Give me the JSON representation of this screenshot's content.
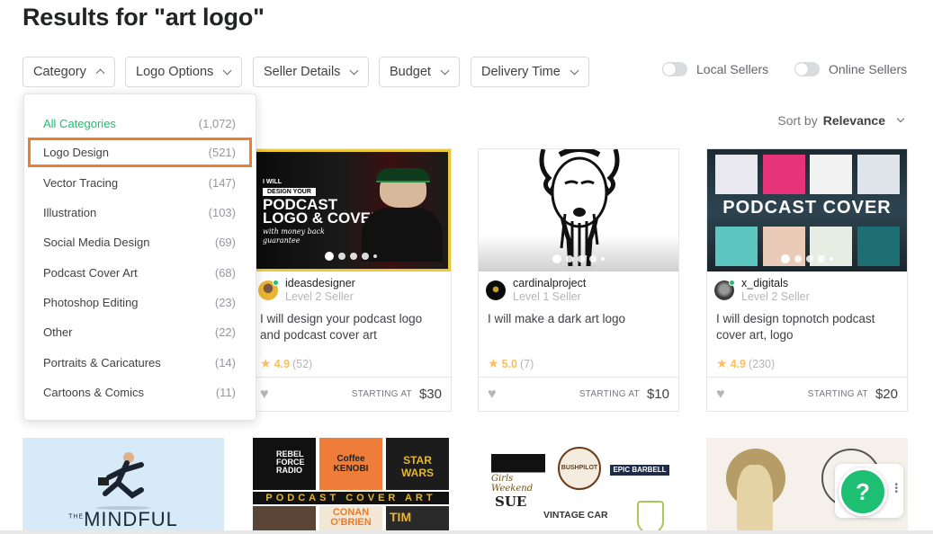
{
  "page": {
    "title": "Results for \"art logo\""
  },
  "filters": [
    {
      "label": "Category",
      "expanded": true
    },
    {
      "label": "Logo Options",
      "expanded": false
    },
    {
      "label": "Seller Details",
      "expanded": false
    },
    {
      "label": "Budget",
      "expanded": false
    },
    {
      "label": "Delivery Time",
      "expanded": false
    }
  ],
  "toggles": [
    {
      "label": "Local Sellers",
      "on": false
    },
    {
      "label": "Online Sellers",
      "on": false
    }
  ],
  "sort": {
    "prefix": "Sort by",
    "value": "Relevance"
  },
  "category_dropdown": {
    "items": [
      {
        "name": "All Categories",
        "count": "(1,072)",
        "active": true
      },
      {
        "name": "Logo Design",
        "count": "(521)",
        "highlighted": true
      },
      {
        "name": "Vector Tracing",
        "count": "(147)"
      },
      {
        "name": "Illustration",
        "count": "(103)"
      },
      {
        "name": "Social Media Design",
        "count": "(69)"
      },
      {
        "name": "Podcast Cover Art",
        "count": "(68)"
      },
      {
        "name": "Photoshop Editing",
        "count": "(23)"
      },
      {
        "name": "Other",
        "count": "(22)"
      },
      {
        "name": "Portraits & Caricatures",
        "count": "(14)"
      },
      {
        "name": "Cartoons & Comics",
        "count": "(11)"
      }
    ]
  },
  "gigs": [
    {
      "thumb": {
        "line1": "I WILL",
        "line2": "DESIGN YOUR",
        "line3": "PODCAST",
        "line4": "LOGO & COVER",
        "line5": "with money back guarantee"
      },
      "seller": "ideasdesigner",
      "level": "Level 2 Seller",
      "online": true,
      "title": "I will design your podcast logo and podcast cover art",
      "rating": "4.9",
      "reviews": "(52)",
      "starting_label": "STARTING AT",
      "price": "$30"
    },
    {
      "thumb": {},
      "seller": "cardinalproject",
      "level": "Level 1 Seller",
      "online": false,
      "title": "I will make a dark art logo",
      "rating": "5.0",
      "reviews": "(7)",
      "starting_label": "STARTING AT",
      "price": "$10"
    },
    {
      "thumb": {
        "banner": "PODCAST COVER"
      },
      "seller": "x_digitals",
      "level": "Level 2 Seller",
      "online": true,
      "title": "I will design topnotch podcast cover art, logo",
      "rating": "4.9",
      "reviews": "(230)",
      "starting_label": "STARTING AT",
      "price": "$20"
    }
  ],
  "row2": {
    "mindful": "MINDFUL",
    "mindful_small": "THE",
    "podcast_art_banner": "PODCAST COVER ART",
    "tiles": [
      "REBEL FORCE RADIO",
      "Coffee KENOBI",
      "STAR WARS",
      "CONAN O'BRIEN",
      "TIM"
    ],
    "logos": [
      "Girls Weekend",
      "BUSHPILOT",
      "EPIC BARBELL",
      "SUE",
      "VINTAGE CAR"
    ]
  },
  "help": {
    "label": "?",
    "more": "⋮"
  },
  "colors": {
    "brand_green": "#1dbf73",
    "highlight_orange": "#ed7e2e",
    "star": "#ffbe5b"
  }
}
